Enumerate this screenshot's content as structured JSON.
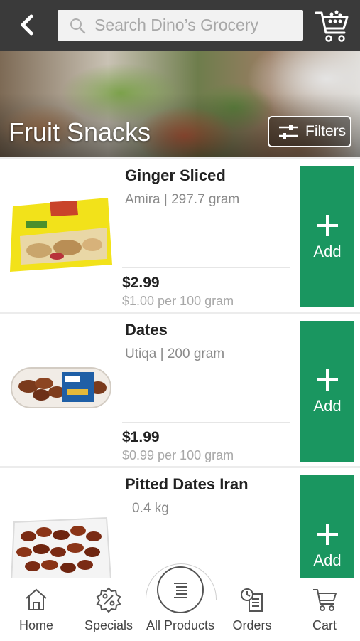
{
  "header": {
    "search_placeholder": "Search Dino’s Grocery",
    "search_icon": "search-icon",
    "back_icon": "back-chevron-icon",
    "cart_icon": "basket-icon"
  },
  "hero": {
    "title": "Fruit Snacks",
    "filters_label": "Filters"
  },
  "products": [
    {
      "name": "Ginger Sliced",
      "brand_size": "Amira | 297.7 gram",
      "price": "$2.99",
      "unit_price": "$1.00 per 100 gram",
      "add_label": "Add"
    },
    {
      "name": "Dates",
      "brand_size": "Utiqa | 200 gram",
      "price": "$1.99",
      "unit_price": "$0.99 per 100 gram",
      "add_label": "Add"
    },
    {
      "name": "Pitted Dates Iran",
      "brand_size": "0.4 kg",
      "price": "",
      "unit_price": "",
      "add_label": "Add"
    }
  ],
  "bottom_nav": [
    {
      "label": "Home"
    },
    {
      "label": "Specials"
    },
    {
      "label": "All Products"
    },
    {
      "label": "Orders"
    },
    {
      "label": "Cart"
    }
  ],
  "colors": {
    "topbar": "#3a3a3a",
    "add_button": "#1a9660"
  }
}
